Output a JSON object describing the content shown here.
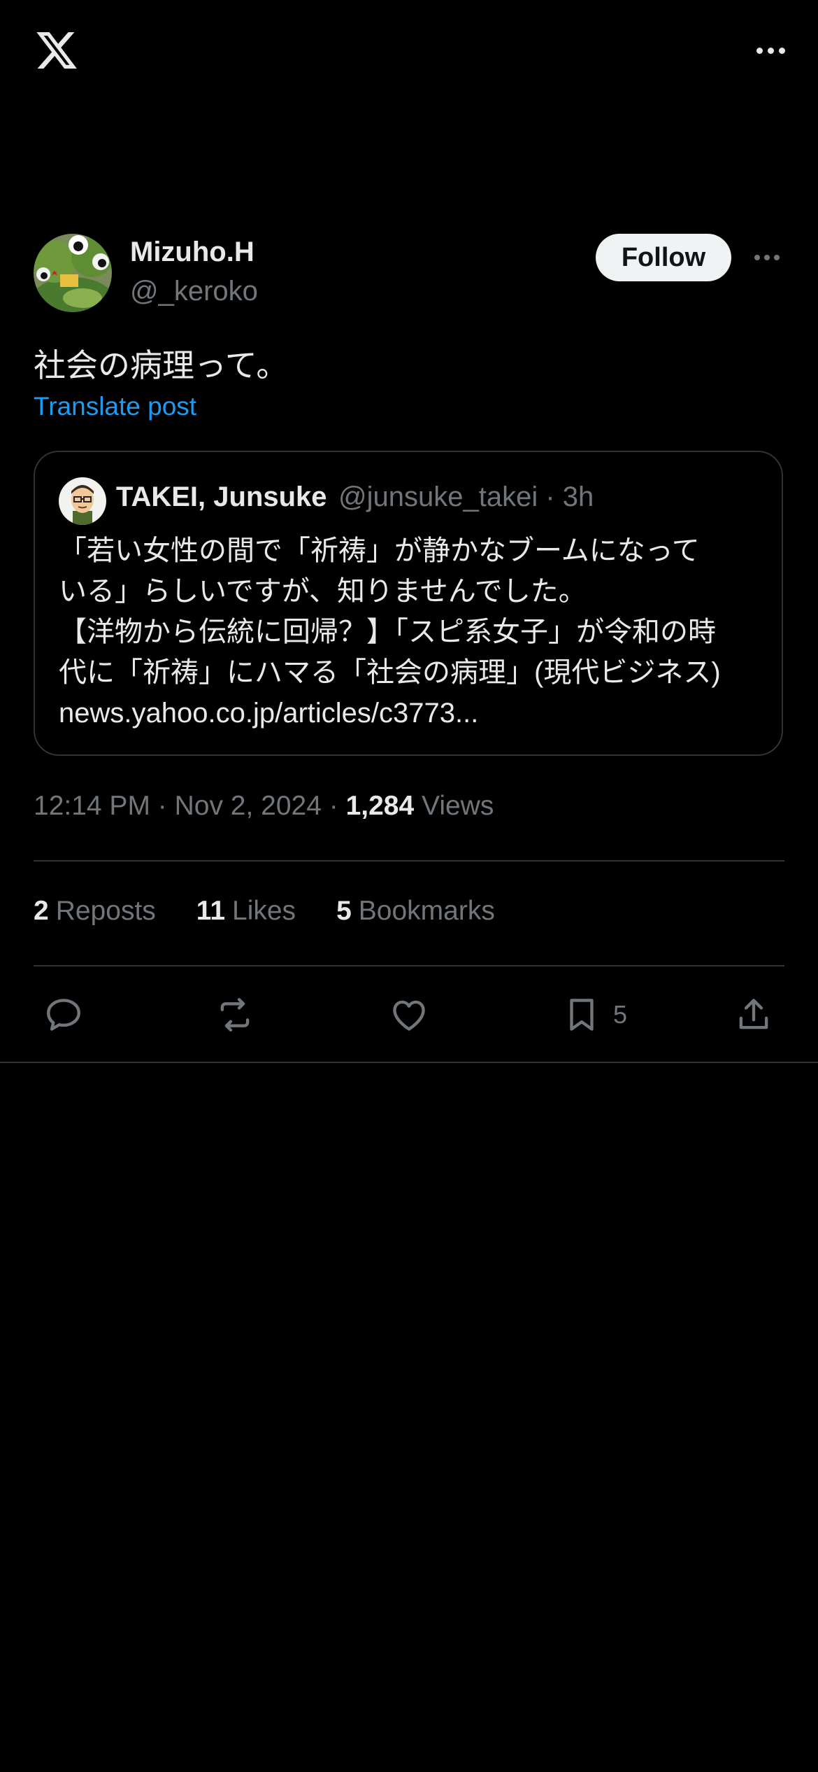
{
  "header": {
    "logo": "x-logo",
    "more_icon": "more-horizontal-icon"
  },
  "post": {
    "author": {
      "name": "Mizuho.H",
      "handle": "@_keroko"
    },
    "follow_label": "Follow",
    "text": "社会の病理って。",
    "translate_label": "Translate post",
    "quote": {
      "name": "TAKEI, Junsuke",
      "meta": "@junsuke_takei · 3h",
      "lines": [
        "「若い女性の間で「祈祷」が静かなブームになって",
        "いる」らしいですが、知りませんでした。",
        "【洋物から伝統に回帰？】「スピ系女子」が令和の時",
        "代に「祈祷」にハマる「社会の病理」(現代ビジネス)",
        "news.yahoo.co.jp/articles/c3773..."
      ]
    },
    "timestamp": "12:14 PM · Nov 2, 2024 · ",
    "views_count": "1,284",
    "views_label": " Views",
    "stats": {
      "reposts_count": "2",
      "reposts_label": "Reposts",
      "likes_count": "11",
      "likes_label": "Likes",
      "bookmarks_count": "5",
      "bookmarks_label": "Bookmarks"
    },
    "actions": {
      "reply_icon": "reply-icon",
      "repost_icon": "repost-icon",
      "like_icon": "heart-icon",
      "bookmark_icon": "bookmark-icon",
      "bookmark_count": "5",
      "share_icon": "share-icon"
    }
  },
  "colors": {
    "background": "#000000",
    "text_primary": "#e7e9ea",
    "text_secondary": "#71767b",
    "link": "#1d9bf0",
    "border": "#2f3336",
    "follow_bg": "#eff3f4"
  }
}
